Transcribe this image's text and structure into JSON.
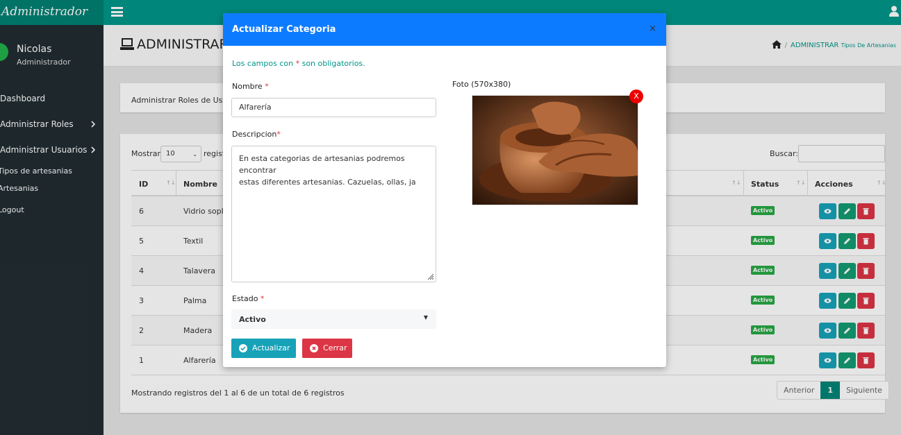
{
  "brand": "Administrador",
  "user": {
    "name": "Nicolas",
    "role": "Administrador"
  },
  "sidebar": {
    "items": [
      {
        "label": "Dashboard"
      },
      {
        "label": "Administrar Roles"
      },
      {
        "label": "Administrar Usuarios"
      },
      {
        "label": "Tipos de artesanias"
      },
      {
        "label": "Artesanias"
      },
      {
        "label": "Logout"
      }
    ]
  },
  "page": {
    "title": "ADMINISTRAR",
    "breadcrumb": {
      "current": "ADMINISTRAR",
      "sub": "Tipos De Artesanias"
    },
    "tile_text": "Administrar Roles de Usuar"
  },
  "table": {
    "show_label": "Mostrar",
    "show_value": "10",
    "show_suffix": "regist",
    "search_label": "Buscar:",
    "headers": {
      "id": "ID",
      "name": "Nombre",
      "status": "Status",
      "actions": "Acciones"
    },
    "rows": [
      {
        "id": "6",
        "name": "Vidrio sopla",
        "status": "Activo"
      },
      {
        "id": "5",
        "name": "Textil",
        "status": "Activo"
      },
      {
        "id": "4",
        "name": "Talavera",
        "status": "Activo"
      },
      {
        "id": "3",
        "name": "Palma",
        "status": "Activo"
      },
      {
        "id": "2",
        "name": "Madera",
        "status": "Activo"
      },
      {
        "id": "1",
        "name": "Alfarería",
        "status": "Activo"
      }
    ],
    "info": "Mostrando registros del 1 al 6 de un total de 6 registros",
    "pager": {
      "prev": "Anterior",
      "current": "1",
      "next": "Siguiente"
    }
  },
  "modal": {
    "title": "Actualizar Categoria",
    "close": "×",
    "required_note_before": "Los campos con",
    "required_star": "*",
    "required_note_after": "son obligatorios.",
    "nombre_label": "Nombre",
    "nombre_value": "Alfarería",
    "descripcion_label": "Descripcion",
    "descripcion_value": "En esta categorias de artesanias podremos encontrar\nestas diferentes artesanias. Cazuelas, ollas, ja",
    "estado_label": "Estado",
    "estado_value": "Activo",
    "foto_label": "Foto (570x380)",
    "remove_photo": "X",
    "update_button": "Actualizar",
    "close_button": "Cerrar"
  },
  "colors": {
    "topbar": "#009688",
    "sidebar": "#222d32",
    "modal_header": "#0d7bff",
    "info": "#17a2b8",
    "danger": "#dc3545",
    "success": "#28a745"
  }
}
